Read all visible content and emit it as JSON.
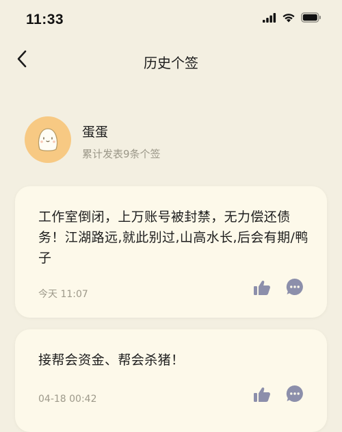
{
  "status_bar": {
    "time": "11:33",
    "icons": [
      "signal-icon",
      "wifi-icon",
      "battery-icon"
    ]
  },
  "nav": {
    "title": "历史个签",
    "back_icon": "chevron-left-icon"
  },
  "profile": {
    "nickname": "蛋蛋",
    "post_count": "累计发表9条个签",
    "avatar_color": "#f7c983"
  },
  "posts": [
    {
      "text": "工作室倒闭，上万账号被封禁，无力偿还债务！江湖路远,就此别过,山高水长,后会有期/鸭子",
      "time": "今天 11:07"
    },
    {
      "text": "接帮会资金、帮会杀猪！",
      "time": "04-18 00:42"
    }
  ],
  "colors": {
    "background": "#f3efe1",
    "card": "#fdf9ea",
    "icon": "#8c8fab",
    "secondary_text": "#9d998a"
  }
}
